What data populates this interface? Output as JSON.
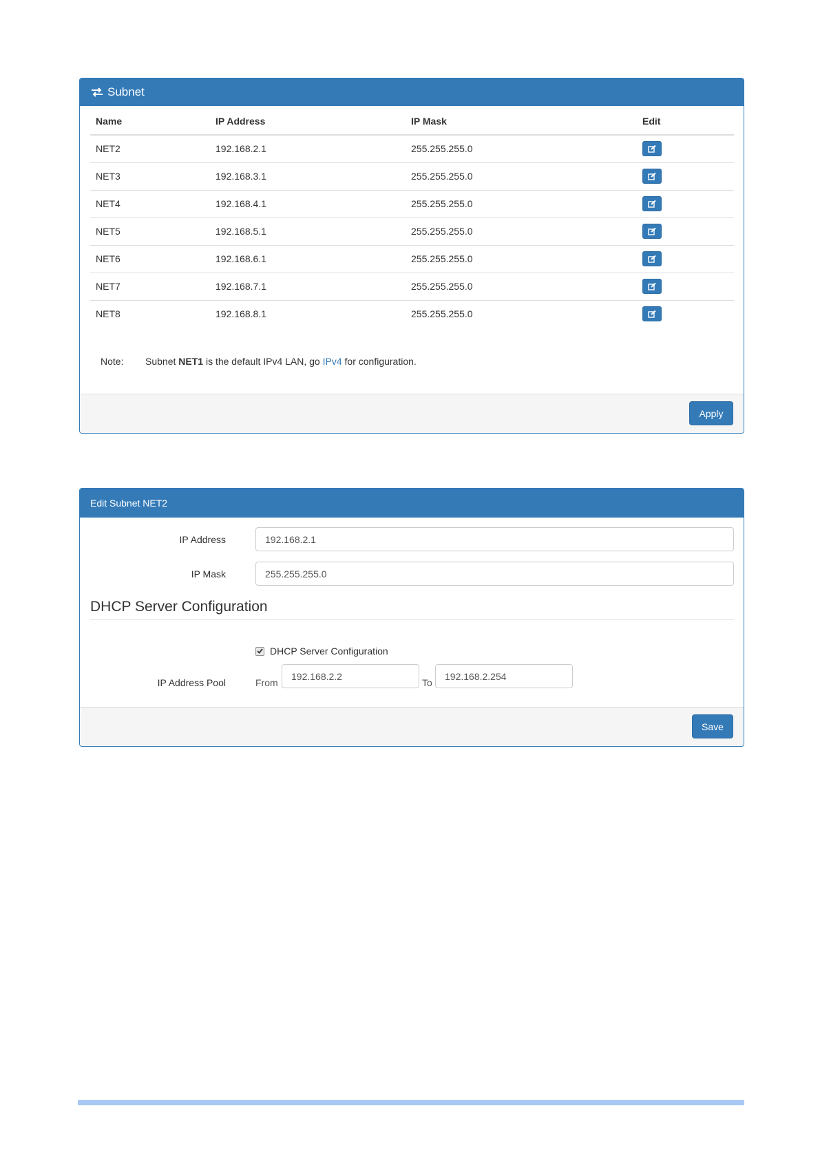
{
  "subnet_panel": {
    "title": "Subnet",
    "columns": {
      "name": "Name",
      "ip": "IP Address",
      "mask": "IP Mask",
      "edit": "Edit"
    },
    "rows": [
      {
        "name": "NET2",
        "ip": "192.168.2.1",
        "mask": "255.255.255.0"
      },
      {
        "name": "NET3",
        "ip": "192.168.3.1",
        "mask": "255.255.255.0"
      },
      {
        "name": "NET4",
        "ip": "192.168.4.1",
        "mask": "255.255.255.0"
      },
      {
        "name": "NET5",
        "ip": "192.168.5.1",
        "mask": "255.255.255.0"
      },
      {
        "name": "NET6",
        "ip": "192.168.6.1",
        "mask": "255.255.255.0"
      },
      {
        "name": "NET7",
        "ip": "192.168.7.1",
        "mask": "255.255.255.0"
      },
      {
        "name": "NET8",
        "ip": "192.168.8.1",
        "mask": "255.255.255.0"
      }
    ],
    "note": {
      "label": "Note:",
      "prefix": "Subnet ",
      "bold": "NET1",
      "middle": " is the default IPv4 LAN, go ",
      "link": "IPv4",
      "suffix": " for configuration."
    },
    "apply_label": "Apply"
  },
  "edit_panel": {
    "title": "Edit Subnet NET2",
    "ip_label": "IP Address",
    "ip_value": "192.168.2.1",
    "mask_label": "IP Mask",
    "mask_value": "255.255.255.0",
    "section_title": "DHCP Server Configuration",
    "dhcp_checkbox_label": "DHCP Server Configuration",
    "dhcp_enabled": true,
    "pool_label": "IP Address Pool",
    "from_label": "From",
    "from_value": "192.168.2.2",
    "to_label": "To",
    "to_value": "192.168.2.254",
    "save_label": "Save"
  },
  "colors": {
    "primary": "#337ab7",
    "footer_bar": "#a9c8f5"
  },
  "icons": {
    "header": "exchange-icon",
    "edit": "edit-icon",
    "checkbox": "check-icon"
  }
}
